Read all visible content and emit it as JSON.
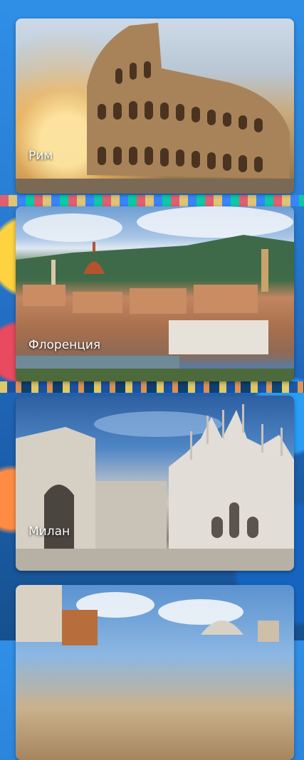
{
  "cities": [
    {
      "name": "Рим"
    },
    {
      "name": "Флоренция"
    },
    {
      "name": "Милан"
    },
    {
      "name": ""
    }
  ]
}
